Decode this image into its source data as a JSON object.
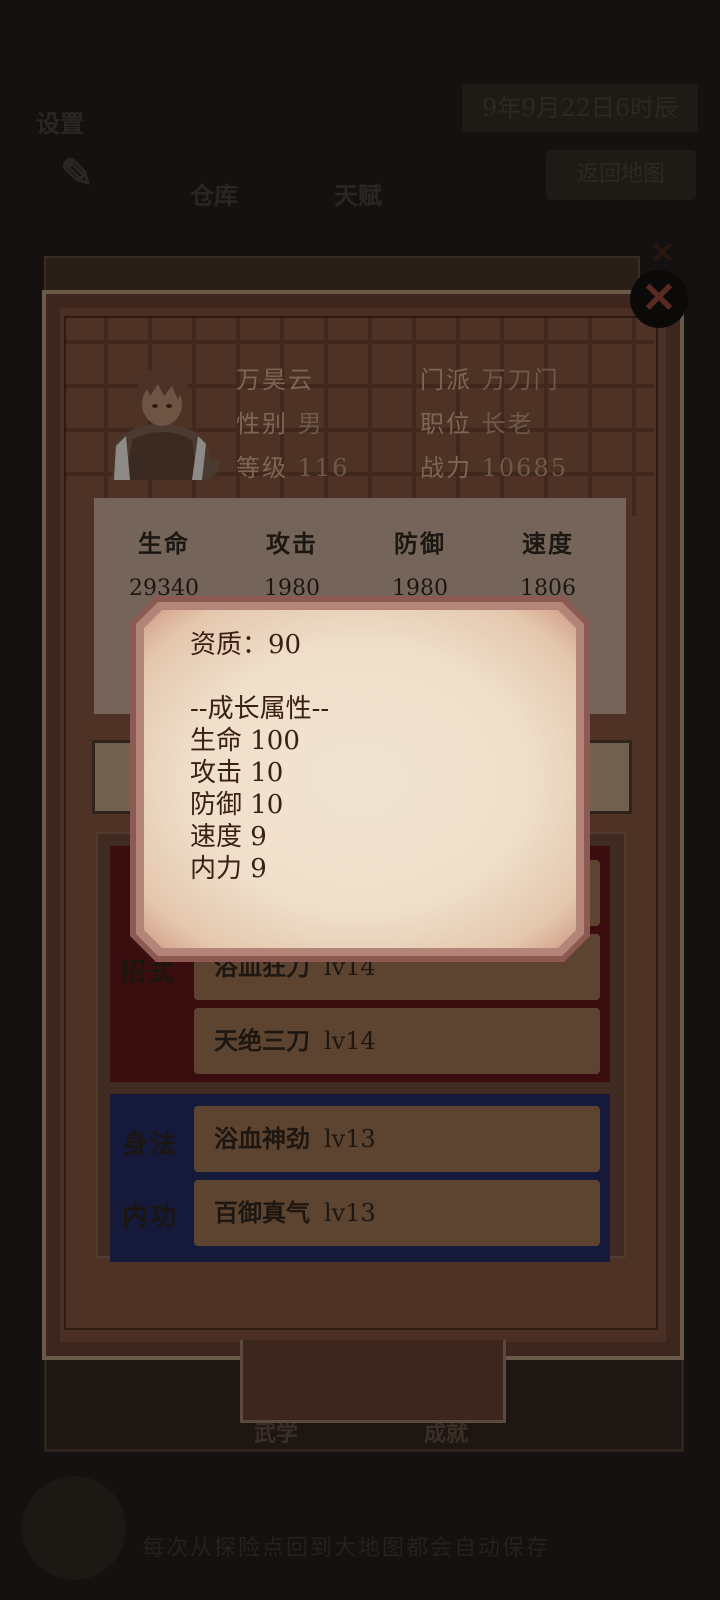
{
  "background": {
    "settings_label": "设置",
    "warehouse_label": "仓库",
    "talent_label": "天赋",
    "date_text": "9年9月22日6时辰",
    "map_button": "返回地图",
    "bottom_tab_1": "武学",
    "bottom_tab_2": "成就",
    "tip_text": "每次从探险点回到大地图都会自动保存"
  },
  "character": {
    "name": "万昊云",
    "sect_label": "门派",
    "sect_value": "万刀门",
    "gender_label": "性别",
    "gender_value": "男",
    "position_label": "职位",
    "position_value": "长老",
    "level_label": "等级",
    "level_value": "116",
    "power_label": "战力",
    "power_value": "10685"
  },
  "stats": {
    "headers": [
      "生命",
      "攻击",
      "防御",
      "速度"
    ],
    "values": [
      "29340",
      "1980",
      "1980",
      "1806"
    ]
  },
  "skills": {
    "moves_label": "招式",
    "movement_label": "身法",
    "inner_label": "内功",
    "rows": [
      {
        "name": "浴血狂刀",
        "level": "lv14"
      },
      {
        "name": "天绝三刀",
        "level": "lv14"
      },
      {
        "name": "浴血神劲",
        "level": "lv13"
      },
      {
        "name": "百御真气",
        "level": "lv13"
      }
    ]
  },
  "tooltip": {
    "aptitude": "资质：90",
    "growth_title": "--成长属性--",
    "lines": [
      "生命 100",
      "攻击 10",
      "防御 10",
      "速度 9",
      "内力 9"
    ]
  },
  "close_glyph": "✕",
  "colors": {
    "panel": "#4a2f24",
    "skill_red": "#3a0e0e",
    "skill_blue": "#15193a",
    "popup_paper": "#f1e4d2"
  }
}
